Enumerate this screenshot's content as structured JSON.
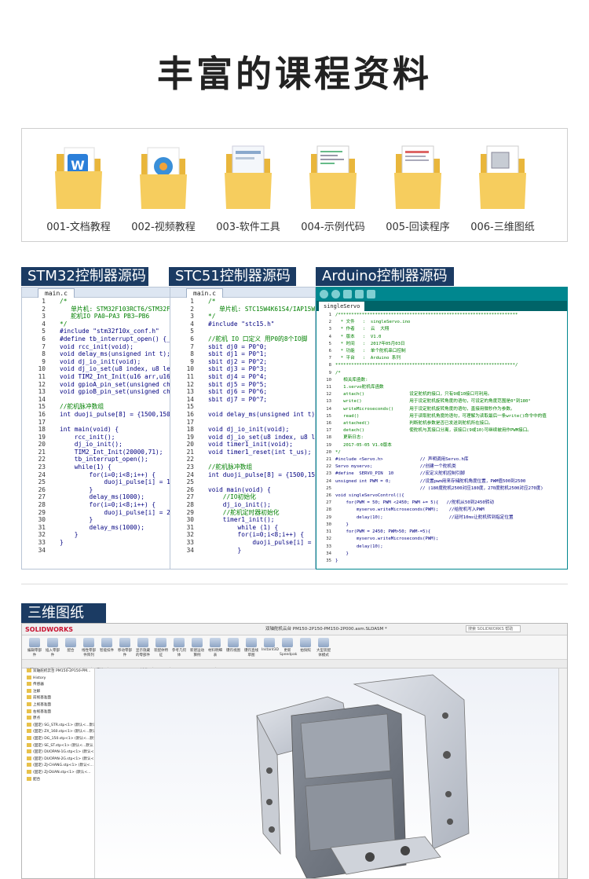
{
  "page": {
    "title": "丰富的课程资料"
  },
  "folders": [
    {
      "label": "001-文档教程",
      "icon": "folder-word-icon"
    },
    {
      "label": "002-视频教程",
      "icon": "folder-video-icon"
    },
    {
      "label": "003-软件工具",
      "icon": "folder-software-icon"
    },
    {
      "label": "004-示例代码",
      "icon": "folder-code-icon"
    },
    {
      "label": "005-回读程序",
      "icon": "folder-readback-icon"
    },
    {
      "label": "006-三维图纸",
      "icon": "folder-3d-icon"
    }
  ],
  "sections": {
    "stm32": "STM32控制器源码",
    "stc51": "STC51控制器源码",
    "arduino": "Arduino控制器源码",
    "cad": "三维图纸"
  },
  "stm32_editor": {
    "tab": "main.c",
    "lines": [
      {
        "n": "1",
        "t": "/*",
        "c": true
      },
      {
        "n": "2",
        "t": "   单片机: STM32F103RCT6/STM32F",
        "c": true
      },
      {
        "n": "3",
        "t": "   舵机IO PA0~PA3 PB3~PB6",
        "c": true
      },
      {
        "n": "4",
        "t": "*/",
        "c": true
      },
      {
        "n": "5",
        "t": "#include \"stm32f10x_conf.h\"",
        "c": false
      },
      {
        "n": "6",
        "t": "#define tb_interrupt_open() {_",
        "c": false
      },
      {
        "n": "7",
        "t": "void rcc_init(void);",
        "c": false
      },
      {
        "n": "8",
        "t": "void delay_ms(unsigned int t);",
        "c": false
      },
      {
        "n": "9",
        "t": "void dj_io_init(void);",
        "c": false
      },
      {
        "n": "10",
        "t": "void dj_io_set(u8 index, u8 le",
        "c": false
      },
      {
        "n": "11",
        "t": "void TIM2_Int_Init(u16 arr,u16",
        "c": false
      },
      {
        "n": "12",
        "t": "void gpioA_pin_set(unsigned ch",
        "c": false
      },
      {
        "n": "13",
        "t": "void gpioB_pin_set(unsigned ch",
        "c": false
      },
      {
        "n": "14",
        "t": "",
        "c": false
      },
      {
        "n": "15",
        "t": "//舵机脉冲数组",
        "c": true
      },
      {
        "n": "16",
        "t": "int duoji_pulse[8] = {1500,150",
        "c": false
      },
      {
        "n": "17",
        "t": "",
        "c": false
      },
      {
        "n": "18",
        "t": "int main(void) {",
        "c": false
      },
      {
        "n": "19",
        "t": "    rcc_init();",
        "c": false
      },
      {
        "n": "20",
        "t": "    dj_io_init();",
        "c": false
      },
      {
        "n": "21",
        "t": "    TIM2_Int_Init(20000,71);",
        "c": false
      },
      {
        "n": "22",
        "t": "    tb_interrupt_open();",
        "c": false
      },
      {
        "n": "23",
        "t": "    while(1) {",
        "c": false
      },
      {
        "n": "24",
        "t": "        for(i=0;i<8;i++) {",
        "c": false
      },
      {
        "n": "25",
        "t": "            duoji_pulse[i] = 1000;/",
        "c": false
      },
      {
        "n": "26",
        "t": "        }",
        "c": false
      },
      {
        "n": "27",
        "t": "        delay_ms(1000);",
        "c": false
      },
      {
        "n": "28",
        "t": "        for(i=0;i<8;i++) {",
        "c": false
      },
      {
        "n": "29",
        "t": "            duoji_pulse[i] = 2000;/",
        "c": false
      },
      {
        "n": "30",
        "t": "        }",
        "c": false
      },
      {
        "n": "31",
        "t": "        delay_ms(1000);",
        "c": false
      },
      {
        "n": "32",
        "t": "    }",
        "c": false
      },
      {
        "n": "33",
        "t": "}",
        "c": false
      },
      {
        "n": "34",
        "t": "",
        "c": false
      }
    ]
  },
  "stc51_editor": {
    "tab": "main.c",
    "lines": [
      {
        "n": "1",
        "t": "/*",
        "c": true
      },
      {
        "n": "2",
        "t": "   单片机: STC15W4K61S4/IAP15W4K6",
        "c": true
      },
      {
        "n": "3",
        "t": "*/",
        "c": true
      },
      {
        "n": "4",
        "t": "#include \"stc15.h\"",
        "c": false
      },
      {
        "n": "5",
        "t": "",
        "c": false
      },
      {
        "n": "6",
        "t": "//舵机 IO 口定义 用P0的8个IO脚",
        "c": true
      },
      {
        "n": "7",
        "t": "sbit dj0 = P0^0;",
        "c": false
      },
      {
        "n": "8",
        "t": "sbit dj1 = P0^1;",
        "c": false
      },
      {
        "n": "9",
        "t": "sbit dj2 = P0^2;",
        "c": false
      },
      {
        "n": "10",
        "t": "sbit dj3 = P0^3;",
        "c": false
      },
      {
        "n": "11",
        "t": "sbit dj4 = P0^4;",
        "c": false
      },
      {
        "n": "12",
        "t": "sbit dj5 = P0^5;",
        "c": false
      },
      {
        "n": "13",
        "t": "sbit dj6 = P0^6;",
        "c": false
      },
      {
        "n": "14",
        "t": "sbit dj7 = P0^7;",
        "c": false
      },
      {
        "n": "15",
        "t": "",
        "c": false
      },
      {
        "n": "16",
        "t": "void delay_ms(unsigned int t);",
        "c": false
      },
      {
        "n": "17",
        "t": "",
        "c": false
      },
      {
        "n": "18",
        "t": "void dj_io_init(void);",
        "c": false
      },
      {
        "n": "19",
        "t": "void dj_io_set(u8 index, u8 le",
        "c": false
      },
      {
        "n": "20",
        "t": "void timer1_init(void);",
        "c": false
      },
      {
        "n": "21",
        "t": "void timer1_reset(int t_us);",
        "c": false
      },
      {
        "n": "22",
        "t": "",
        "c": false
      },
      {
        "n": "23",
        "t": "//舵机脉冲数组",
        "c": true
      },
      {
        "n": "24",
        "t": "int duoji_pulse[8] = {1500,150",
        "c": false
      },
      {
        "n": "25",
        "t": "",
        "c": false
      },
      {
        "n": "26",
        "t": "void main(void) {",
        "c": false
      },
      {
        "n": "27",
        "t": "    //IO初始化",
        "c": true
      },
      {
        "n": "28",
        "t": "    dj_io_init();",
        "c": false
      },
      {
        "n": "29",
        "t": "    //舵机定时器初始化",
        "c": true
      },
      {
        "n": "30",
        "t": "    timer1_init();",
        "c": false
      },
      {
        "n": "31",
        "t": "        while (1) {",
        "c": false
      },
      {
        "n": "32",
        "t": "        for(i=0;i<8;i++) {",
        "c": false
      },
      {
        "n": "33",
        "t": "            duoji_pulse[i] = 1000;/",
        "c": false
      },
      {
        "n": "34",
        "t": "        }",
        "c": false
      }
    ]
  },
  "arduino_editor": {
    "tab": "singleServo",
    "lines": [
      {
        "n": "1",
        "t": "/********************************************************************",
        "c": true
      },
      {
        "n": "2",
        "t": "  * 文件   :  singleServo.ino",
        "c": true
      },
      {
        "n": "3",
        "t": "  * 作者   :  云  大翔",
        "c": true
      },
      {
        "n": "4",
        "t": "  * 版本   :  V1.0",
        "c": true
      },
      {
        "n": "5",
        "t": "  * 时间   :  2017年05月03日",
        "c": true
      },
      {
        "n": "6",
        "t": "  * 功能   :  单个舵机串口控制",
        "c": true
      },
      {
        "n": "7",
        "t": "  * 平台   :  Arduino 系列",
        "c": true
      },
      {
        "n": "8",
        "t": "********************************************************************/",
        "c": true
      },
      {
        "n": "9",
        "t": "/*",
        "c": true
      },
      {
        "n": "10",
        "t": "   相关库函数:",
        "c": true
      },
      {
        "n": "11",
        "t": "   1.servo舵机库函数",
        "c": true
      },
      {
        "n": "12",
        "t": "   attach()                 设定舵机的接口，只有9或10接口可利用。",
        "c": true
      },
      {
        "n": "13",
        "t": "   write()                  用于设定舵机旋转角度的语句，可设定的角度范围是0°到180°",
        "c": true
      },
      {
        "n": "14",
        "t": "   writeMicroseconds()      用于设定舵机旋转角度的语句，直接用微秒作为参数。",
        "c": true
      },
      {
        "n": "15",
        "t": "   read()                   用于读取舵机角度的语句，可理解为读取最后一条write()命令中的值",
        "c": true
      },
      {
        "n": "16",
        "t": "   attached()               判断舵机参数是否已发送到舵机所在接口。",
        "c": true
      },
      {
        "n": "17",
        "t": "   detach()                 使舵机与其接口分离，该接口(9或10)可继续被用作PWM接口。",
        "c": true
      },
      {
        "n": "18",
        "t": "   更新日志:",
        "c": true
      },
      {
        "n": "19",
        "t": "   2017-05-05 V1.0版本",
        "c": true
      },
      {
        "n": "20",
        "t": "*/",
        "c": true
      },
      {
        "n": "21",
        "t": "#include <Servo.h>              // 声明调用Servo.h库",
        "c": false
      },
      {
        "n": "22",
        "t": "Servo myservo;                  //创建一个舵机类",
        "c": false
      },
      {
        "n": "23",
        "t": "#define  SERVO_PIN  10          //宏定义舵机控制引脚",
        "c": false
      },
      {
        "n": "24",
        "t": "unsigned int PWM = 0;           //设置pwm用来存储舵机角度位置，PWM值500到2500",
        "c": false
      },
      {
        "n": "25",
        "t": "                                // (180度舵机2500对应180度，270度舵机2500对应270度)",
        "c": false
      },
      {
        "n": "26",
        "t": "void singleServoControl(){",
        "c": false
      },
      {
        "n": "27",
        "t": "    for(PWM = 50; PWM <2450; PWM += 5){   //舵机从50到2450转动",
        "c": false
      },
      {
        "n": "28",
        "t": "        myservo.writeMicroseconds(PWM);    //给舵机写入PWM",
        "c": false
      },
      {
        "n": "29",
        "t": "        delay(10);                         //延时10ms让舵机转到指定位置",
        "c": false
      },
      {
        "n": "30",
        "t": "    }",
        "c": false
      },
      {
        "n": "31",
        "t": "    for(PWM = 2450; PWM>50; PWM-=5){",
        "c": false
      },
      {
        "n": "32",
        "t": "        myservo.writeMicroseconds(PWM);",
        "c": false
      },
      {
        "n": "33",
        "t": "        delay(10);",
        "c": false
      },
      {
        "n": "34",
        "t": "    }",
        "c": false
      },
      {
        "n": "35",
        "t": "}",
        "c": false
      }
    ]
  },
  "cad": {
    "logo": "SOLIDWORKS",
    "file_title": "双轴舵机云台 PM150-2P150-PM150-2P000.asm.SLDASM *",
    "search_placeholder": "搜索 SOLIDWORKS 帮助",
    "ribbon": [
      "编辑零部件",
      "插入零部件",
      "配合",
      "线性零部件阵列",
      "智能扣件",
      "移动零部件",
      "显示隐藏的零部件",
      "装配体特征",
      "参考几何体",
      "新建运动算例",
      "材料明细表",
      "爆炸视图",
      "爆炸直线草图",
      "Instant3D",
      "更新Speedpak",
      "拍快照",
      "大型装配体模式"
    ],
    "tabs": [
      "装配体",
      "布局",
      "草图",
      "标注",
      "评估",
      "SOLIDWORKS 插件",
      "MBD",
      "SOLIDWORKS CAM"
    ],
    "tree": [
      "双轴舵机云台 PM150-2P150-PM...",
      "History",
      "传感器",
      "注解",
      "前视基准面",
      "上视基准面",
      "右视基准面",
      "原点",
      "(固定) SG_STR.stp<1> (默认<...默认",
      "(固定) ZX_160.stp<1> (默认<...默认",
      "(固定) DG_150.stp<1> (默认<...默认",
      "(固定) SE_ST.stp<1> (默认<...默认",
      "(固定) DUOPAN-1G.stp<1> (默认<...",
      "(固定) DUOPAN-2G.stp<1> (默认<...",
      "(固定) ZJ-CHANG.stp<1> (默认<...",
      "(固定) ZJ-DUAN.stp<1> (默认<...",
      "配合"
    ]
  },
  "colors": {
    "section_bg": "#1b3b63",
    "arduino_teal": "#00878f",
    "folder_yellow": "#f3c24e"
  }
}
